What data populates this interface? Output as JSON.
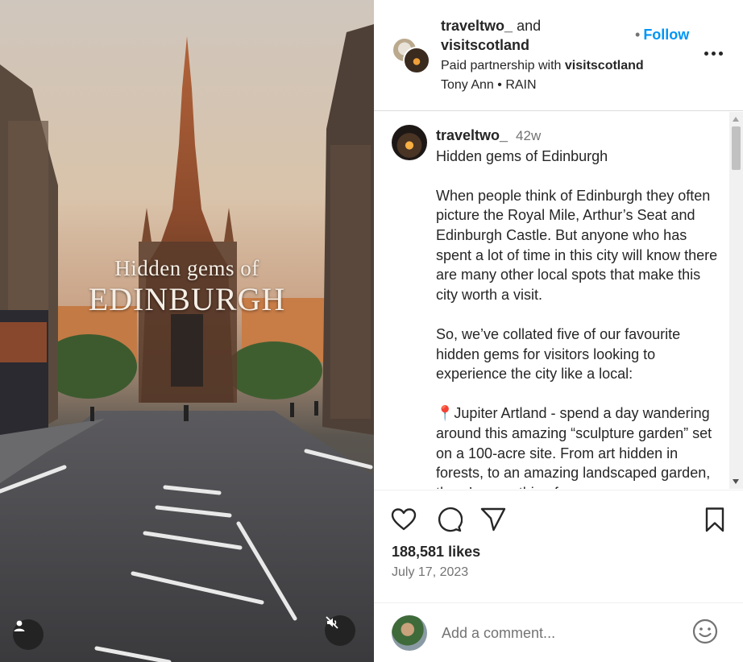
{
  "media": {
    "overlay_line1": "Hidden gems of",
    "overlay_line2": "EDINBURGH",
    "user_icon": "user-icon",
    "mute_icon": "speaker-muted-icon"
  },
  "header": {
    "user1": "traveltwo_",
    "and": "and",
    "user2": "visitscotland",
    "paid_partnership_prefix": "Paid partnership with",
    "partner": "visitscotland",
    "audio": "Tony Ann • RAIN",
    "follow_dot": "•",
    "follow_label": "Follow",
    "more_icon": "more-horizontal-icon"
  },
  "caption": {
    "username": "traveltwo_",
    "time": "42w",
    "title": "Hidden gems of Edinburgh",
    "para1": "When people think of Edinburgh they often picture the Royal Mile, Arthur’s Seat and Edinburgh Castle. But anyone who has spent a lot of time in this city will know there are many other local spots that make this city worth a visit.",
    "para2": "So, we’ve collated five of our favourite hidden gems for visitors looking to experience the city like a local:",
    "pin_emoji": "📍",
    "para3": "Jupiter Artland - spend a day wandering around this amazing “sculpture garden” set on a 100-acre site. From art hidden in forests, to an amazing landscaped garden, there’s something for everyone."
  },
  "actions": {
    "like_icon": "heart-icon",
    "comment_icon": "comment-icon",
    "share_icon": "send-icon",
    "save_icon": "bookmark-icon",
    "likes": "188,581 likes",
    "date": "July 17, 2023"
  },
  "comment": {
    "placeholder": "Add a comment...",
    "emoji_icon": "smiley-icon"
  },
  "colors": {
    "accent": "#0095f6",
    "text": "#262626",
    "muted": "#737373"
  }
}
